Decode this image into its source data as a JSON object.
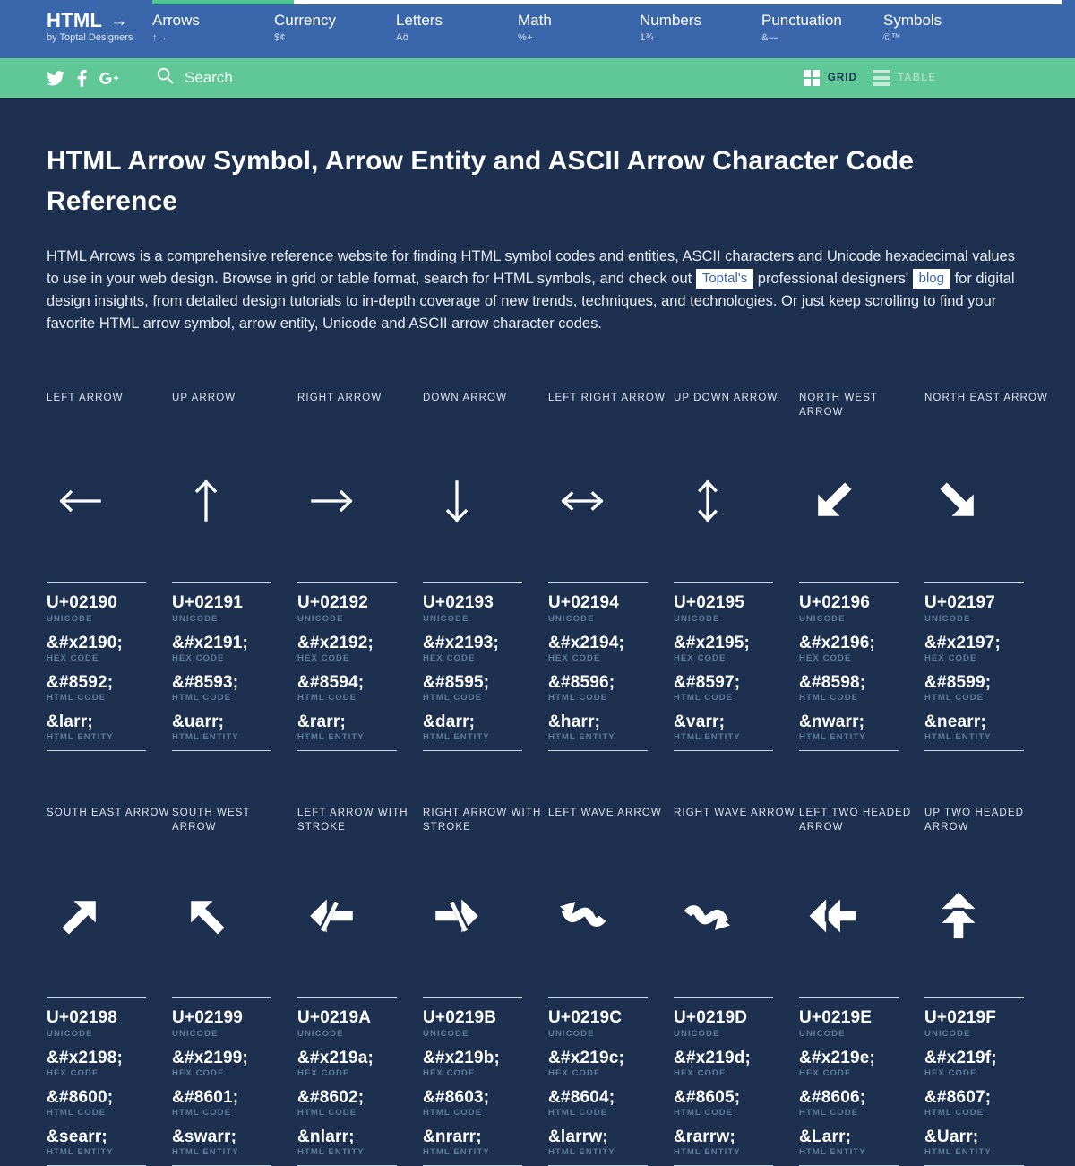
{
  "colors": {
    "nav_blue": "#3a66ab",
    "accent_green": "#4ec492",
    "subbar_green": "#5fc896",
    "page_bg": "#1d3050",
    "label_muted": "#5e7d9b"
  },
  "progress": {
    "blue_width": 170,
    "green_width": 158,
    "white_width": 857
  },
  "brand": {
    "title": "HTML",
    "arrow": "→",
    "subtitle": "by Toptal Designers"
  },
  "nav": {
    "items": [
      {
        "label": "Arrows",
        "symbols": "↑→",
        "active": true
      },
      {
        "label": "Currency",
        "symbols": "$¢",
        "active": false
      },
      {
        "label": "Letters",
        "symbols": "Aö",
        "active": false
      },
      {
        "label": "Math",
        "symbols": "%+",
        "active": false
      },
      {
        "label": "Numbers",
        "symbols": "1¾",
        "active": false
      },
      {
        "label": "Punctuation",
        "symbols": "&—",
        "active": false
      },
      {
        "label": "Symbols",
        "symbols": "©™",
        "active": false
      }
    ]
  },
  "subbar": {
    "social": [
      {
        "name": "twitter",
        "label": "Twitter"
      },
      {
        "name": "facebook",
        "label": "Facebook"
      },
      {
        "name": "googleplus",
        "label": "Google Plus"
      }
    ],
    "search": {
      "placeholder": "Search",
      "value": ""
    },
    "views": [
      {
        "label": "GRID",
        "active": true
      },
      {
        "label": "TABLE",
        "active": false
      }
    ]
  },
  "main": {
    "title": "HTML Arrow Symbol, Arrow Entity and ASCII Arrow Character Code Reference",
    "intro": {
      "part1": "HTML Arrows is a comprehensive reference website for finding HTML symbol codes and entities, ASCII characters and Unicode hexadecimal values to use in your web design. Browse in grid or table format, search for HTML symbols, and check out ",
      "link1": "Toptal's",
      "part2": " professional designers' ",
      "link2": "blog",
      "part3": " for digital design insights, from detailed design tutorials to in-depth coverage of new trends, techniques, and technologies. Or just keep scrolling to find your favorite HTML arrow symbol, arrow entity, Unicode and ASCII arrow character codes."
    },
    "field_labels": {
      "unicode": "UNICODE",
      "hex": "HEX CODE",
      "html": "HTML CODE",
      "entity": "HTML ENTITY"
    },
    "symbols": [
      {
        "name": "LEFT ARROW",
        "glyph": "←",
        "icon": "arrow-left",
        "unicode": "U+02190",
        "hex": "&#x2190;",
        "html": "&#8592;",
        "entity": "&larr;"
      },
      {
        "name": "UP ARROW",
        "glyph": "↑",
        "icon": "arrow-up",
        "unicode": "U+02191",
        "hex": "&#x2191;",
        "html": "&#8593;",
        "entity": "&uarr;"
      },
      {
        "name": "RIGHT ARROW",
        "glyph": "→",
        "icon": "arrow-right",
        "unicode": "U+02192",
        "hex": "&#x2192;",
        "html": "&#8594;",
        "entity": "&rarr;"
      },
      {
        "name": "DOWN ARROW",
        "glyph": "↓",
        "icon": "arrow-down",
        "unicode": "U+02193",
        "hex": "&#x2193;",
        "html": "&#8595;",
        "entity": "&darr;"
      },
      {
        "name": "LEFT RIGHT ARROW",
        "glyph": "↔",
        "icon": "arrow-left-right",
        "unicode": "U+02194",
        "hex": "&#x2194;",
        "html": "&#8596;",
        "entity": "&harr;"
      },
      {
        "name": "UP DOWN ARROW",
        "glyph": "↕",
        "icon": "arrow-up-down",
        "unicode": "U+02195",
        "hex": "&#x2195;",
        "html": "&#8597;",
        "entity": "&varr;"
      },
      {
        "name": "NORTH WEST ARROW",
        "glyph": "↖",
        "icon": "arrow-north-west",
        "unicode": "U+02196",
        "hex": "&#x2196;",
        "html": "&#8598;",
        "entity": "&nwarr;"
      },
      {
        "name": "NORTH EAST ARROW",
        "glyph": "↗",
        "icon": "arrow-north-east",
        "unicode": "U+02197",
        "hex": "&#x2197;",
        "html": "&#8599;",
        "entity": "&nearr;"
      },
      {
        "name": "SOUTH EAST ARROW",
        "glyph": "↘",
        "icon": "arrow-south-east",
        "unicode": "U+02198",
        "hex": "&#x2198;",
        "html": "&#8600;",
        "entity": "&searr;"
      },
      {
        "name": "SOUTH WEST ARROW",
        "glyph": "↙",
        "icon": "arrow-south-west",
        "unicode": "U+02199",
        "hex": "&#x2199;",
        "html": "&#8601;",
        "entity": "&swarr;"
      },
      {
        "name": "LEFT ARROW WITH STROKE",
        "glyph": "↚",
        "icon": "arrow-left-stroke",
        "unicode": "U+0219A",
        "hex": "&#x219a;",
        "html": "&#8602;",
        "entity": "&nlarr;"
      },
      {
        "name": "RIGHT ARROW WITH STROKE",
        "glyph": "↛",
        "icon": "arrow-right-stroke",
        "unicode": "U+0219B",
        "hex": "&#x219b;",
        "html": "&#8603;",
        "entity": "&nrarr;"
      },
      {
        "name": "LEFT WAVE ARROW",
        "glyph": "↜",
        "icon": "arrow-left-wave",
        "unicode": "U+0219C",
        "hex": "&#x219c;",
        "html": "&#8604;",
        "entity": "&larrw;"
      },
      {
        "name": "RIGHT WAVE ARROW",
        "glyph": "↝",
        "icon": "arrow-right-wave",
        "unicode": "U+0219D",
        "hex": "&#x219d;",
        "html": "&#8605;",
        "entity": "&rarrw;"
      },
      {
        "name": "LEFT TWO HEADED ARROW",
        "glyph": "↞",
        "icon": "arrow-left-two-headed",
        "unicode": "U+0219E",
        "hex": "&#x219e;",
        "html": "&#8606;",
        "entity": "&Larr;"
      },
      {
        "name": "UP TWO HEADED ARROW",
        "glyph": "↟",
        "icon": "arrow-up-two-headed",
        "unicode": "U+0219F",
        "hex": "&#x219f;",
        "html": "&#8607;",
        "entity": "&Uarr;"
      }
    ]
  }
}
